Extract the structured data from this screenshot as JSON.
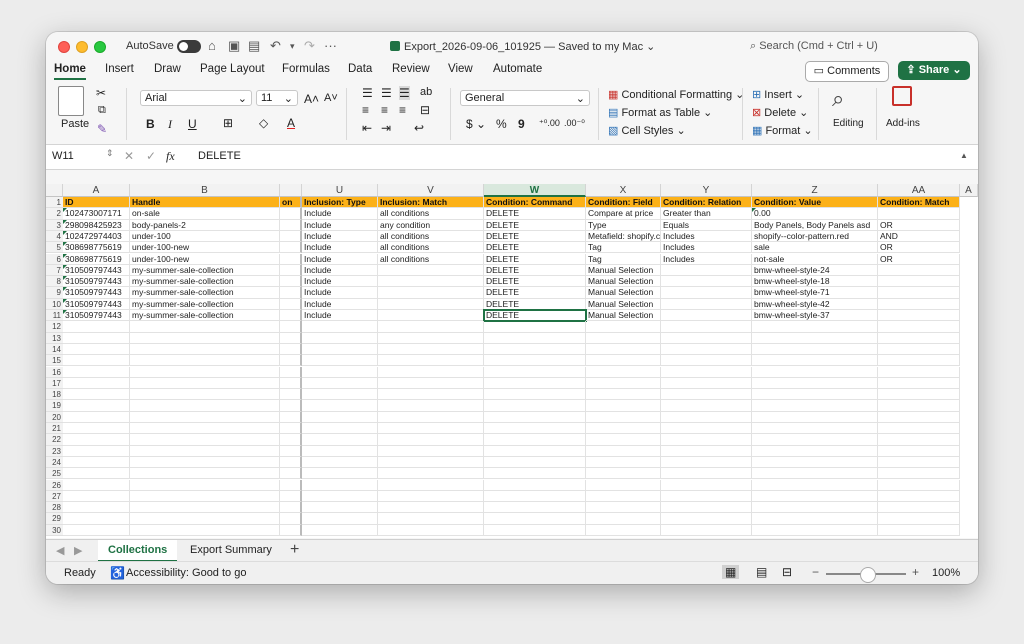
{
  "titlebar": {
    "autosave_label": "AutoSave",
    "document_title": "Export_2026-09-06_101925 — Saved to my Mac ⌄",
    "search_placeholder": "Search (Cmd + Ctrl + U)"
  },
  "menu": {
    "tabs": [
      "Home",
      "Insert",
      "Draw",
      "Page Layout",
      "Formulas",
      "Data",
      "Review",
      "View",
      "Automate"
    ],
    "active_tab": "Home",
    "comments_label": "Comments",
    "share_label": "Share"
  },
  "ribbon": {
    "paste_label": "Paste",
    "font_name": "Arial",
    "font_size": "11",
    "number_format": "General",
    "conditional_formatting": "Conditional Formatting",
    "format_as_table": "Format as Table",
    "cell_styles": "Cell Styles",
    "insert_label": "Insert",
    "delete_label": "Delete",
    "format_label": "Format",
    "editing_label": "Editing",
    "addins_label": "Add-ins"
  },
  "formula_bar": {
    "name_box": "W11",
    "fx": "fx",
    "content": "DELETE"
  },
  "grid": {
    "column_letters": [
      "",
      "A",
      "B",
      "",
      "U",
      "V",
      "W",
      "X",
      "Y",
      "Z",
      "AA",
      "A"
    ],
    "header_row": [
      "ID",
      "Handle",
      "on",
      "Inclusion: Type",
      "Inclusion: Match",
      "Condition: Command",
      "Condition: Field",
      "Condition: Relation",
      "Condition: Value",
      "Condition: Match"
    ],
    "rows": [
      [
        "102473007171",
        "on-sale",
        "",
        "Include",
        "all conditions",
        "DELETE",
        "Compare at price",
        "Greater than",
        "0.00",
        ""
      ],
      [
        "298098425923",
        "body-panels-2",
        "",
        "Include",
        "any condition",
        "DELETE",
        "Type",
        "Equals",
        "Body Panels, Body Panels asd",
        "OR"
      ],
      [
        "102472974403",
        "under-100",
        "",
        "Include",
        "all conditions",
        "DELETE",
        "Metafield: shopify.c",
        "Includes",
        "shopify--color-pattern.red",
        "AND"
      ],
      [
        "308698775619",
        "under-100-new",
        "",
        "Include",
        "all conditions",
        "DELETE",
        "Tag",
        "Includes",
        "sale",
        "OR"
      ],
      [
        "308698775619",
        "under-100-new",
        "",
        "Include",
        "all conditions",
        "DELETE",
        "Tag",
        "Includes",
        "not-sale",
        "OR"
      ],
      [
        "310509797443",
        "my-summer-sale-collection",
        "",
        "Include",
        "",
        "DELETE",
        "Manual Selection",
        "",
        "bmw-wheel-style-24",
        ""
      ],
      [
        "310509797443",
        "my-summer-sale-collection",
        "",
        "Include",
        "",
        "DELETE",
        "Manual Selection",
        "",
        "bmw-wheel-style-18",
        ""
      ],
      [
        "310509797443",
        "my-summer-sale-collection",
        "",
        "Include",
        "",
        "DELETE",
        "Manual Selection",
        "",
        "bmw-wheel-style-71",
        ""
      ],
      [
        "310509797443",
        "my-summer-sale-collection",
        "",
        "Include",
        "",
        "DELETE",
        "Manual Selection",
        "",
        "bmw-wheel-style-42",
        ""
      ],
      [
        "310509797443",
        "my-summer-sale-collection",
        "",
        "Include",
        "",
        "DELETE",
        "Manual Selection",
        "",
        "bmw-wheel-style-37",
        ""
      ]
    ],
    "row_numbers": [
      "1",
      "2",
      "3",
      "4",
      "5",
      "6",
      "7",
      "8",
      "9",
      "10",
      "11",
      "12",
      "13",
      "14",
      "15",
      "16",
      "17",
      "18",
      "19",
      "20",
      "21",
      "22",
      "23",
      "24",
      "25",
      "26",
      "27",
      "28",
      "29",
      "30"
    ],
    "active_cell": "W11"
  },
  "sheets": {
    "tabs": [
      "Collections",
      "Export Summary"
    ],
    "active": "Collections",
    "add_label": "+"
  },
  "status": {
    "ready": "Ready",
    "accessibility": "Accessibility: Good to go",
    "zoom": "100%"
  },
  "colors": {
    "accent": "#1f7244",
    "header_fill": "#fcb118"
  }
}
